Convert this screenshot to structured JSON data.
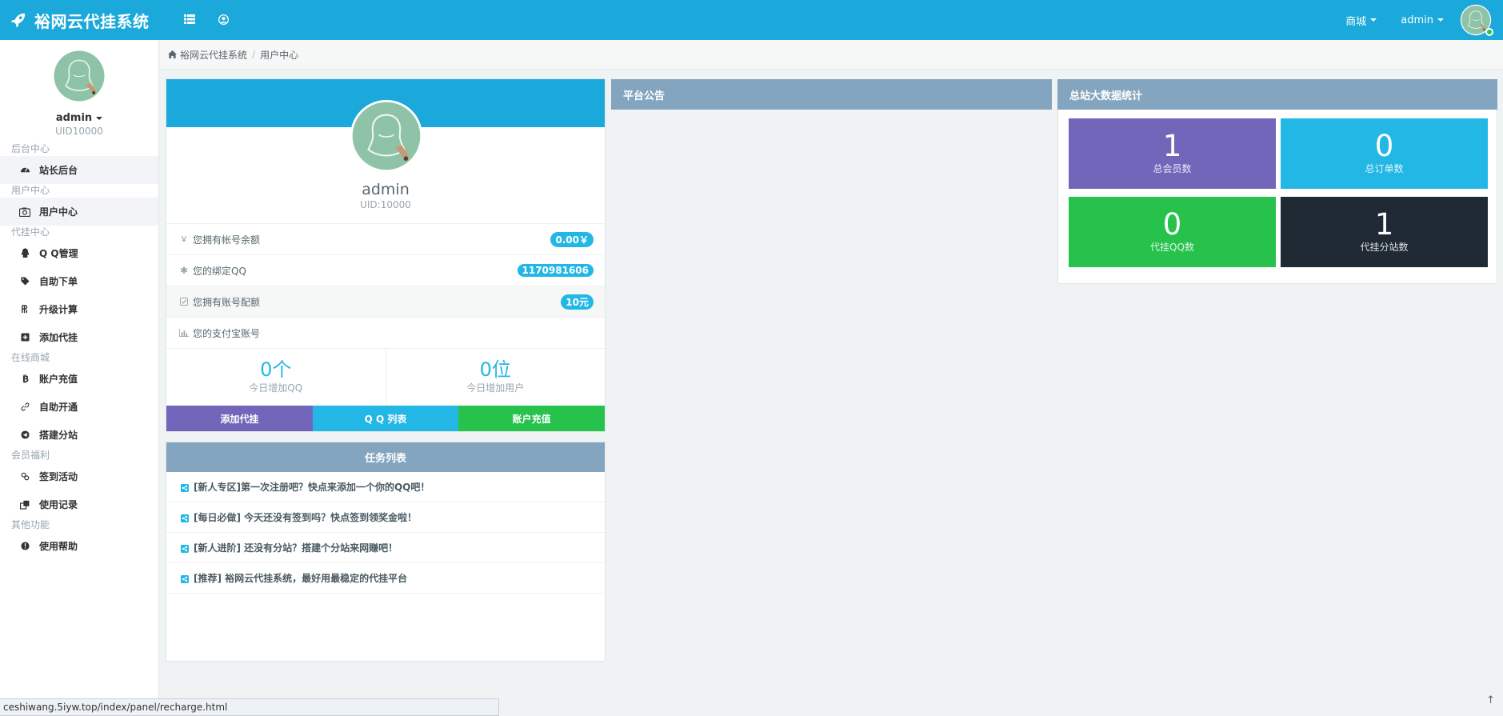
{
  "app": {
    "brand": "裕网云代挂系统",
    "colors": {
      "primary": "#1ba8da",
      "panel_head": "#84a5bf",
      "purple": "#7266ba",
      "info": "#23b7e5",
      "success": "#27c24c",
      "dark": "#1f2a34"
    }
  },
  "topbar": {
    "menu_icon": "list-icon",
    "user_icon": "user-circle-icon",
    "shop_label": "商城",
    "user_label": "admin"
  },
  "sidebar": {
    "name": "admin",
    "uid": "UID10000",
    "groups": [
      {
        "header": "后台中心",
        "items": [
          {
            "label": "站长后台",
            "icon": "dashboard-icon",
            "active": true
          }
        ]
      },
      {
        "header": "用户中心",
        "items": [
          {
            "label": "用户中心",
            "icon": "camera-icon",
            "active": true
          }
        ]
      },
      {
        "header": "代挂中心",
        "items": [
          {
            "label": "Q Q管理",
            "icon": "qq-icon"
          },
          {
            "label": "自助下单",
            "icon": "tag-icon"
          },
          {
            "label": "升级计算",
            "icon": "calculator-icon"
          },
          {
            "label": "添加代挂",
            "icon": "plus-square-icon"
          }
        ]
      },
      {
        "header": "在线商城",
        "items": [
          {
            "label": "账户充值",
            "icon": "bitcoin-icon"
          },
          {
            "label": "自助开通",
            "icon": "link-icon"
          },
          {
            "label": "搭建分站",
            "icon": "telegram-icon"
          }
        ]
      },
      {
        "header": "会员福利",
        "items": [
          {
            "label": "签到活动",
            "icon": "chain-icon"
          },
          {
            "label": "使用记录",
            "icon": "clone-icon"
          }
        ]
      },
      {
        "header": "其他功能",
        "items": [
          {
            "label": "使用帮助",
            "icon": "info-circle-icon"
          }
        ]
      }
    ]
  },
  "breadcrumb": {
    "home": "裕网云代挂系统",
    "current": "用户中心"
  },
  "profile": {
    "name": "admin",
    "uid": "UID:10000",
    "rows": [
      {
        "icon": "yen-icon",
        "label": "您拥有帐号余额",
        "value": "0.00￥"
      },
      {
        "icon": "asterisk-icon",
        "label": "您的绑定QQ",
        "value": "1170981606"
      },
      {
        "icon": "check-square-icon",
        "label": "您拥有账号配额",
        "value": "10元"
      },
      {
        "icon": "bar-chart-icon",
        "label": "您的支付宝账号",
        "value": ""
      }
    ],
    "stats": [
      {
        "value": "0个",
        "caption": "今日增加QQ"
      },
      {
        "value": "0位",
        "caption": "今日增加用户"
      }
    ],
    "buttons": [
      {
        "label": "添加代挂",
        "color": "#7266ba"
      },
      {
        "label": "Q Q 列表",
        "color": "#23b7e5"
      },
      {
        "label": "账户充值",
        "color": "#27c24c"
      }
    ]
  },
  "tasks": {
    "title": "任务列表",
    "items": [
      "[新人专区]第一次注册吧？快点来添加一个你的QQ吧！",
      "[每日必做] 今天还没有签到吗？快点签到领奖金啦！",
      "[新人进阶] 还没有分站？搭建个分站来网赚吧！",
      "[推荐] 裕网云代挂系统，最好用最稳定的代挂平台"
    ]
  },
  "notice": {
    "title": "平台公告"
  },
  "site_stats": {
    "title": "总站大数据统计",
    "boxes": [
      {
        "value": "1",
        "caption": "总会员数",
        "color": "#7266ba"
      },
      {
        "value": "0",
        "caption": "总订单数",
        "color": "#23b7e5"
      },
      {
        "value": "0",
        "caption": "代挂QQ数",
        "color": "#27c24c"
      },
      {
        "value": "1",
        "caption": "代挂分站数",
        "color": "#1f2a34"
      }
    ]
  },
  "statusbar": {
    "url": "ceshiwang.5iyw.top/index/panel/recharge.html"
  }
}
